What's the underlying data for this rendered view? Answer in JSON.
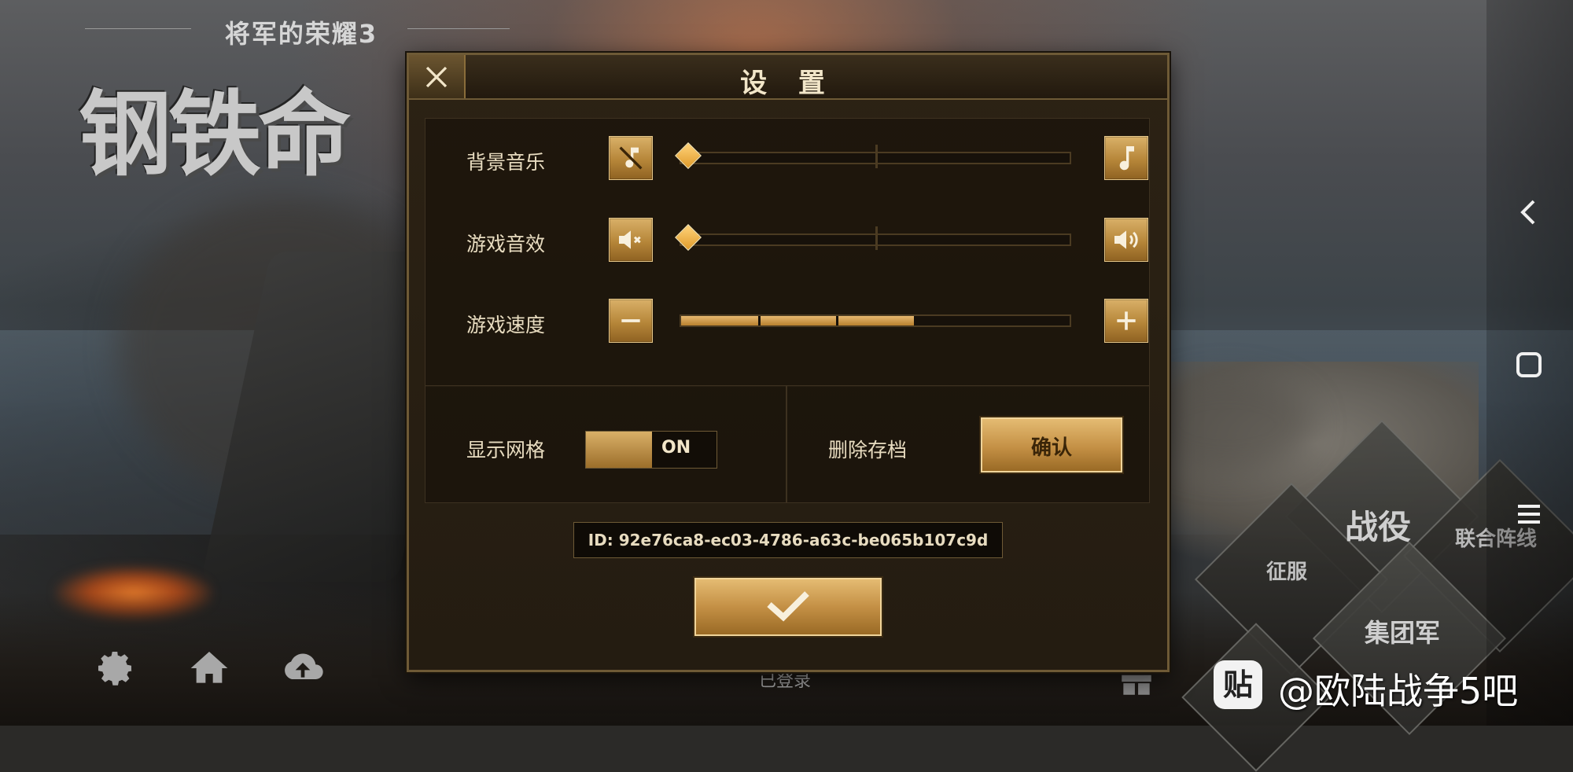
{
  "game": {
    "subtitle": "将军的荣耀3",
    "logo": "钢铁命"
  },
  "dialog": {
    "title": "设 置",
    "rows": [
      {
        "label": "背景音乐",
        "left_icon": "music-off-icon",
        "right_icon": "music-note-icon",
        "value": 0
      },
      {
        "label": "游戏音效",
        "left_icon": "speaker-mute-icon",
        "right_icon": "speaker-on-icon",
        "value": 0
      },
      {
        "label": "游戏速度",
        "left_icon": "minus-icon",
        "right_icon": "plus-icon",
        "value": 3,
        "max": 5
      }
    ],
    "grid": {
      "label": "显示网格",
      "state": "ON"
    },
    "delete_save": {
      "label": "删除存档",
      "button": "确认"
    },
    "player_id": "ID: 92e76ca8-ec03-4786-a63c-be065b107c9d"
  },
  "menu": {
    "campaign": "战役",
    "alliance": "联合阵线",
    "conquest": "征服",
    "army_group": "集团军"
  },
  "status": {
    "logged_in": "已登录"
  },
  "watermark": {
    "icon_char": "贴",
    "text": "@欧陆战争5吧"
  },
  "colors": {
    "gold": "#c49045",
    "panel": "#241c11",
    "border": "#6e5a36"
  }
}
